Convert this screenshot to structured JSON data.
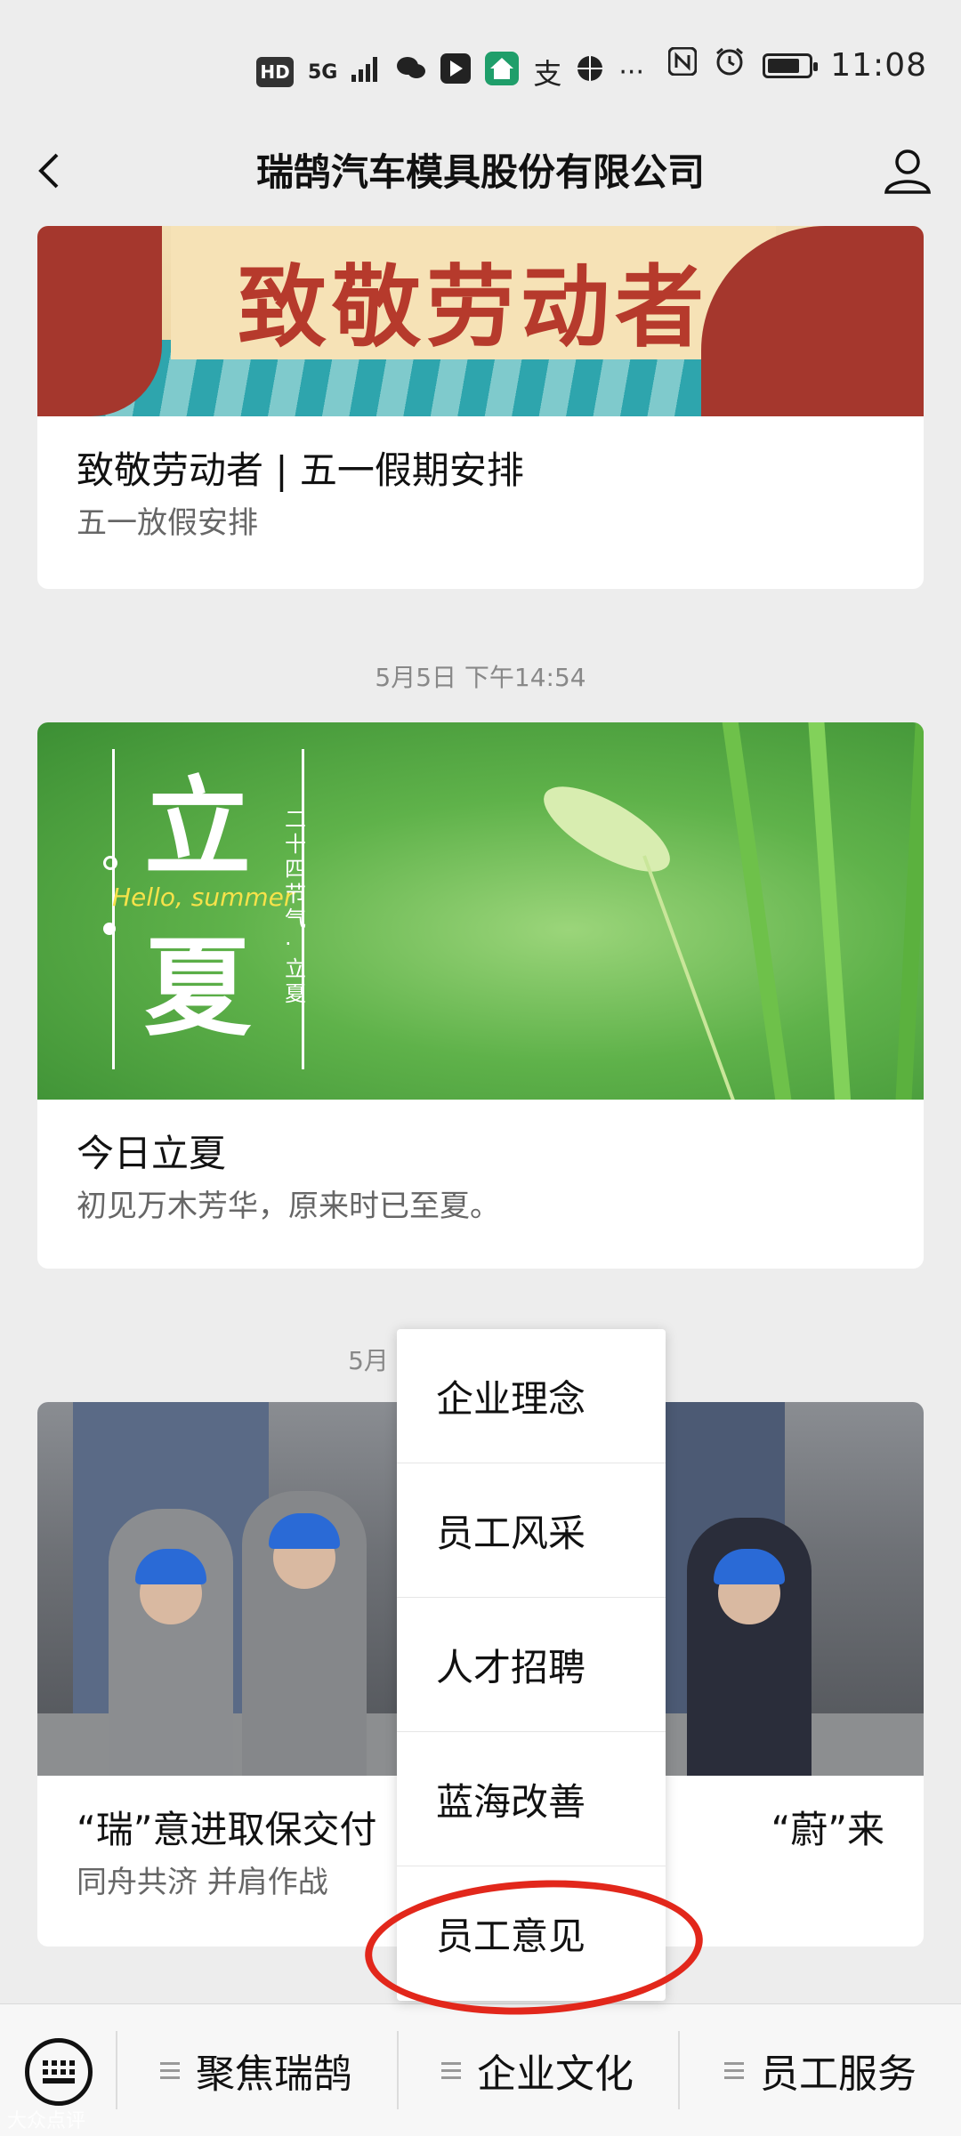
{
  "status_bar": {
    "network_badge": "HD",
    "signal": "5G",
    "more": "···",
    "time": "11:08",
    "battery_level": 0.8
  },
  "nav": {
    "title": "瑞鹄汽车模具股份有限公司"
  },
  "feed": [
    {
      "banner_text": "致敬劳动者",
      "title": "致敬劳动者 | 五一假期安排",
      "subtitle": "五一放假安排"
    },
    {
      "timestamp": "5月5日 下午14:54",
      "banner_text": "立夏",
      "banner_hello": "Hello, summer",
      "banner_vertical": "二十四节气·立夏",
      "title": "今日立夏",
      "subtitle": "初见万木芳华，原来时已至夏。"
    },
    {
      "timestamp_partial": "5月",
      "title_left": "“瑞”意进取保交付",
      "title_right": "“蔚”来",
      "subtitle": "同舟共济 并肩作战"
    }
  ],
  "popup_menu": {
    "items": [
      "企业理念",
      "员工风采",
      "人才招聘",
      "蓝海改善",
      "员工意见"
    ],
    "highlighted": "员工意见"
  },
  "bottom_menu": {
    "tabs": [
      "聚焦瑞鹄",
      "企业文化",
      "员工服务"
    ]
  },
  "watermark": "大众点评"
}
